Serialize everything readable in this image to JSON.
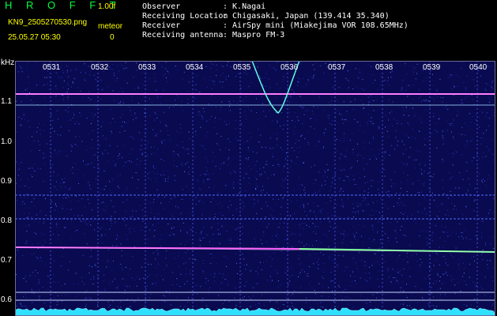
{
  "app": {
    "title": "H R O F F T",
    "version": "1.00f"
  },
  "file": {
    "name": "KN9_2505270530.png",
    "datetime": "25.05.27 05:30"
  },
  "meteor": {
    "label": "meteor",
    "count": "0"
  },
  "info": [
    {
      "key": "Observer",
      "value": ": K.Nagai"
    },
    {
      "key": "Receiving Location",
      "value": ": Chigasaki, Japan (139.414 35.340)"
    },
    {
      "key": "Receiver",
      "value": ": AirSpy mini (Miakejima VOR 108.65MHz)"
    },
    {
      "key": "Receiving antenna",
      "value": ": Maspro FM-3"
    }
  ],
  "axis": {
    "unit": "kHz",
    "y_ticks": [
      "1.1",
      "1.0",
      "0.9",
      "0.8",
      "0.7",
      "0.6"
    ],
    "x_ticks": [
      "0531",
      "0532",
      "0533",
      "0534",
      "0535",
      "0536",
      "0537",
      "0538",
      "0539",
      "0540"
    ]
  },
  "colors": {
    "background": "#000000",
    "spectrum": "#0a0a50",
    "title": "#00ff40",
    "meta": "#ffff00",
    "text": "#ffffff",
    "carrier": "#ff60ff",
    "trace": "#60ffe0"
  }
}
